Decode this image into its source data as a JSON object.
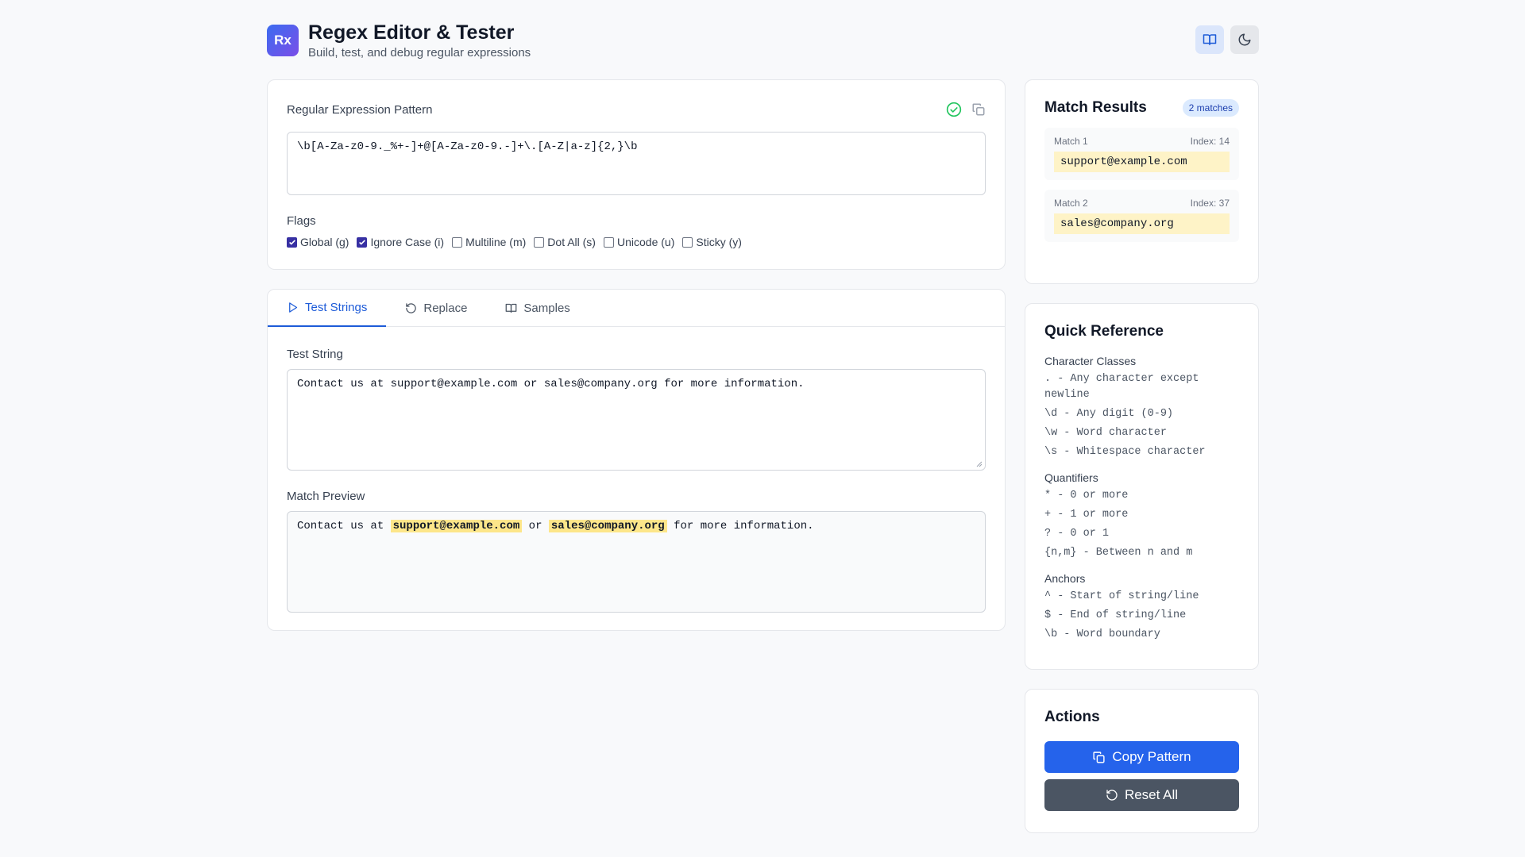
{
  "header": {
    "logo_text": "Rx",
    "title": "Regex Editor & Tester",
    "subtitle": "Build, test, and debug regular expressions"
  },
  "pattern": {
    "label": "Regular Expression Pattern",
    "value": "\\b[A-Za-z0-9._%+-]+@[A-Za-z0-9.-]+\\.[A-Z|a-z]{2,}\\b",
    "valid": true
  },
  "flags": {
    "label": "Flags",
    "items": [
      {
        "label": "Global (g)",
        "checked": true
      },
      {
        "label": "Ignore Case (i)",
        "checked": true
      },
      {
        "label": "Multiline (m)",
        "checked": false
      },
      {
        "label": "Dot All (s)",
        "checked": false
      },
      {
        "label": "Unicode (u)",
        "checked": false
      },
      {
        "label": "Sticky (y)",
        "checked": false
      }
    ]
  },
  "tabs": [
    {
      "label": "Test Strings",
      "icon": "play-icon",
      "active": true
    },
    {
      "label": "Replace",
      "icon": "rotate-icon",
      "active": false
    },
    {
      "label": "Samples",
      "icon": "book-icon",
      "active": false
    }
  ],
  "test": {
    "label": "Test String",
    "value": "Contact us at support@example.com or sales@company.org for more information."
  },
  "preview": {
    "label": "Match Preview",
    "parts": [
      {
        "text": "Contact us at ",
        "match": false
      },
      {
        "text": "support@example.com",
        "match": true
      },
      {
        "text": " or ",
        "match": false
      },
      {
        "text": "sales@company.org",
        "match": true
      },
      {
        "text": " for more information.",
        "match": false
      }
    ]
  },
  "results": {
    "title": "Match Results",
    "badge": "2 matches",
    "matches": [
      {
        "label": "Match 1",
        "index": "Index: 14",
        "value": "support@example.com"
      },
      {
        "label": "Match 2",
        "index": "Index: 37",
        "value": "sales@company.org"
      }
    ]
  },
  "reference": {
    "title": "Quick Reference",
    "sections": [
      {
        "title": "Character Classes",
        "items": [
          ". - Any character except newline",
          "\\d - Any digit (0-9)",
          "\\w - Word character",
          "\\s - Whitespace character"
        ]
      },
      {
        "title": "Quantifiers",
        "items": [
          "* - 0 or more",
          "+ - 1 or more",
          "? - 0 or 1",
          "{n,m} - Between n and m"
        ]
      },
      {
        "title": "Anchors",
        "items": [
          "^ - Start of string/line",
          "$ - End of string/line",
          "\\b - Word boundary"
        ]
      }
    ]
  },
  "actions": {
    "title": "Actions",
    "copy_label": "Copy Pattern",
    "reset_label": "Reset All"
  },
  "colors": {
    "accent": "#2563eb",
    "match_highlight": "#fde68a",
    "valid": "#22c55e"
  }
}
